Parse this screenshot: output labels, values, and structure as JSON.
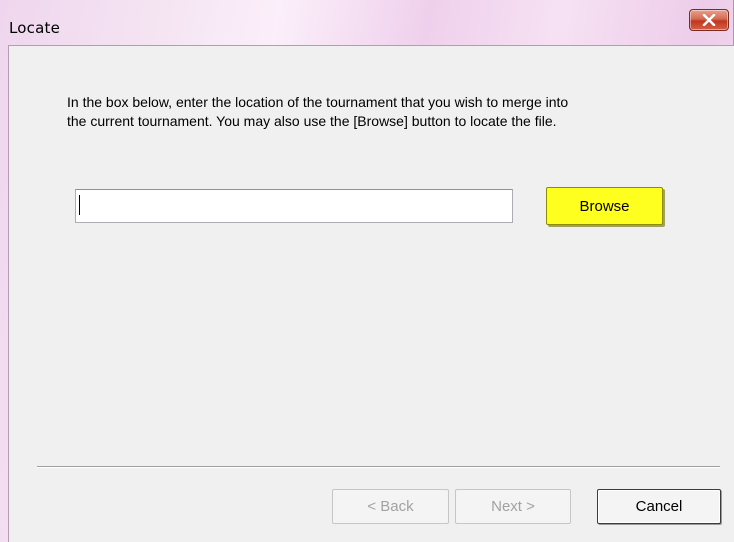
{
  "window": {
    "title": "Locate",
    "close_icon": "close-x-icon"
  },
  "instructions": {
    "line1": "In the box below, enter the location of the tournament that you wish to merge into",
    "line2": "the current tournament.  You may also use the [Browse] button to locate the file."
  },
  "location": {
    "value": "",
    "placeholder": ""
  },
  "buttons": {
    "browse": "Browse",
    "back": "< Back",
    "next": "Next >",
    "cancel": "Cancel"
  },
  "colors": {
    "browse_highlight": "#ffff1f",
    "close_button": "#c2361d",
    "disabled_text": "#a2a2a2"
  }
}
